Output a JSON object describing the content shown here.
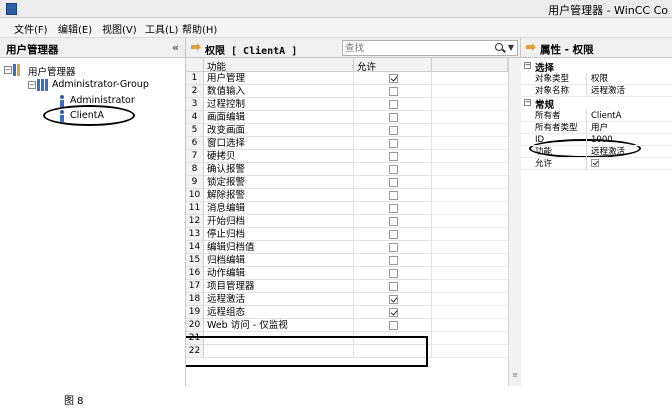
{
  "window": {
    "title": "用户管理器 - WinCC Co"
  },
  "menu": [
    {
      "label": "文件(F)"
    },
    {
      "label": "编辑(E)"
    },
    {
      "label": "视图(V)"
    },
    {
      "label": "工具(L)"
    },
    {
      "label": "帮助(H)"
    }
  ],
  "left_panel": {
    "title": "用户管理器",
    "collapse_glyph": "«",
    "tree": [
      {
        "label": "用户管理器",
        "expander": "−"
      },
      {
        "label": "Administrator-Group",
        "expander": "−"
      },
      {
        "label": "Administrator"
      },
      {
        "label": "ClientA"
      }
    ]
  },
  "mid_panel": {
    "title": "权限 [ ClientA ]",
    "search_placeholder": "查找",
    "columns": [
      "功能",
      "允许"
    ],
    "rows": [
      {
        "num": "1",
        "func": "用户管理",
        "allowed": true
      },
      {
        "num": "2",
        "func": "数值输入",
        "allowed": false
      },
      {
        "num": "3",
        "func": "过程控制",
        "allowed": false
      },
      {
        "num": "4",
        "func": "画面编辑",
        "allowed": false
      },
      {
        "num": "5",
        "func": "改变画面",
        "allowed": false
      },
      {
        "num": "6",
        "func": "窗口选择",
        "allowed": false
      },
      {
        "num": "7",
        "func": "硬拷贝",
        "allowed": false
      },
      {
        "num": "8",
        "func": "确认报警",
        "allowed": false
      },
      {
        "num": "9",
        "func": "锁定报警",
        "allowed": false
      },
      {
        "num": "10",
        "func": "解除报警",
        "allowed": false
      },
      {
        "num": "11",
        "func": "消息编辑",
        "allowed": false
      },
      {
        "num": "12",
        "func": "开始归档",
        "allowed": false
      },
      {
        "num": "13",
        "func": "停止归档",
        "allowed": false
      },
      {
        "num": "14",
        "func": "编辑归档值",
        "allowed": false
      },
      {
        "num": "15",
        "func": "归档编辑",
        "allowed": false
      },
      {
        "num": "16",
        "func": "动作编辑",
        "allowed": false
      },
      {
        "num": "17",
        "func": "项目管理器",
        "allowed": false
      },
      {
        "num": "18",
        "func": "远程激活",
        "allowed": true
      },
      {
        "num": "19",
        "func": "远程组态",
        "allowed": true
      },
      {
        "num": "20",
        "func": "Web 访问 - 仅监视",
        "allowed": false
      },
      {
        "num": "21",
        "func": "",
        "allowed": null
      },
      {
        "num": "22",
        "func": "",
        "allowed": null
      }
    ],
    "grip_glyph": "≡"
  },
  "right_panel": {
    "title": "属性 - 权限",
    "categories": [
      {
        "label": "选择",
        "expander": "−",
        "props": [
          {
            "key": "对象类型",
            "value": "权限"
          },
          {
            "key": "对象名称",
            "value": "远程激活"
          }
        ]
      },
      {
        "label": "常规",
        "expander": "−",
        "props": [
          {
            "key": "所有者",
            "value": "ClientA"
          },
          {
            "key": "所有者类型",
            "value": "用户"
          },
          {
            "key": "ID",
            "value": "1000"
          },
          {
            "key": "功能",
            "value": "远程激活"
          },
          {
            "key": "允许",
            "value": "",
            "checkbox": true
          }
        ]
      }
    ]
  },
  "caption": "图 8"
}
